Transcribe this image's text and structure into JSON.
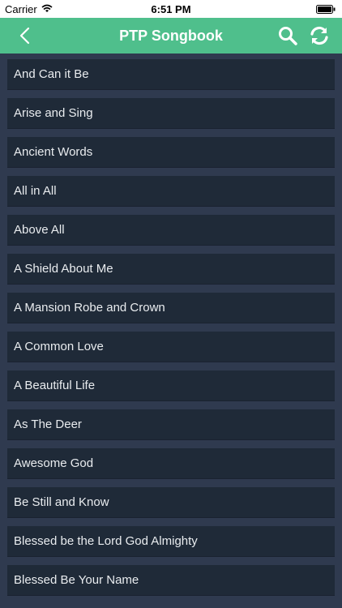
{
  "status_bar": {
    "carrier": "Carrier",
    "time": "6:51 PM"
  },
  "nav": {
    "title": "PTP Songbook",
    "back_icon": "chevron-left-icon",
    "search_icon": "search-icon",
    "refresh_icon": "refresh-icon"
  },
  "colors": {
    "nav_background": "#4fbf8c",
    "list_background": "#2f3a4f",
    "row_background": "#1f2a38",
    "row_text": "#e9ecef"
  },
  "songs": [
    "And Can it Be",
    "Arise and Sing",
    "Ancient Words",
    "All in All",
    "Above All",
    "A Shield About Me",
    "A Mansion Robe and Crown",
    "A Common Love",
    "A Beautiful Life",
    "As The Deer",
    "Awesome God",
    "Be Still and Know",
    "Blessed be the Lord God Almighty",
    "Blessed Be Your Name"
  ]
}
